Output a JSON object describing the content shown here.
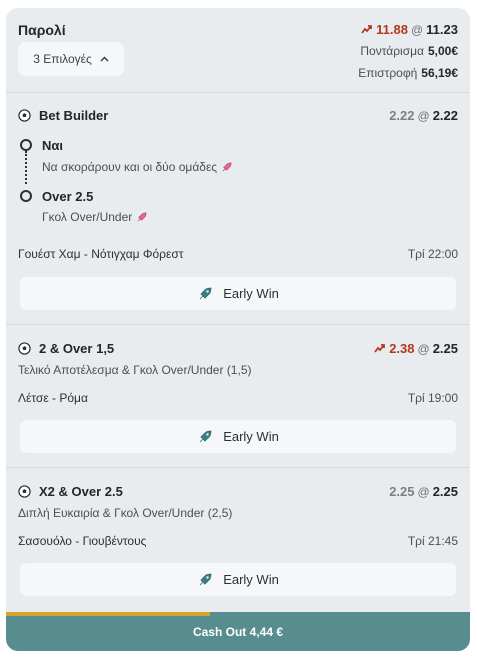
{
  "header": {
    "title": "Παρολί",
    "odds_old": "11.88",
    "odds_at": "@",
    "odds_new": "11.23",
    "selections_label": "3 Επιλογές",
    "stake_label": "Ποντάρισμα",
    "stake_value": "5,00€",
    "return_label": "Επιστροφή",
    "return_value": "56,19€"
  },
  "bets": [
    {
      "title": "Bet Builder",
      "odds_old": "2.22",
      "odds_new": "2.22",
      "odds_trend": "none",
      "legs": [
        {
          "title": "Ναι",
          "sub": "Να σκοράρουν και οι δύο ομάδες"
        },
        {
          "title": "Over 2.5",
          "sub": "Γκολ Over/Under"
        }
      ],
      "match": "Γουέστ Χαμ - Νότιγχαμ Φόρεστ",
      "time": "Τρί 22:00",
      "early_win": "Early Win"
    },
    {
      "title": "2 & Over 1,5",
      "odds_old": "2.38",
      "odds_new": "2.25",
      "odds_trend": "up",
      "sub": "Τελικό Αποτέλεσμα & Γκολ Over/Under (1,5)",
      "match": "Λέτσε - Ρόμα",
      "time": "Τρί 19:00",
      "early_win": "Early Win"
    },
    {
      "title": "X2 & Over 2.5",
      "odds_old": "2.25",
      "odds_new": "2.25",
      "odds_trend": "none",
      "sub": "Διπλή Ευκαιρία & Γκολ Over/Under (2,5)",
      "match": "Σασουόλο - Γιουβέντους",
      "time": "Τρί 21:45",
      "early_win": "Early Win"
    }
  ],
  "cashout": {
    "label": "Cash Out 4,44 €",
    "progress": 0.44
  },
  "colors": {
    "odds_changed": "#b5371e",
    "cashout_bg": "#588d90",
    "cashout_progress": "#d4a52a"
  },
  "icons": {
    "trend": "trend-up-arrow-icon",
    "ball": "soccer-ball-icon",
    "rocket": "rocket-icon",
    "early_win": "early-win-icon",
    "chevron": "chevron-up-icon"
  }
}
